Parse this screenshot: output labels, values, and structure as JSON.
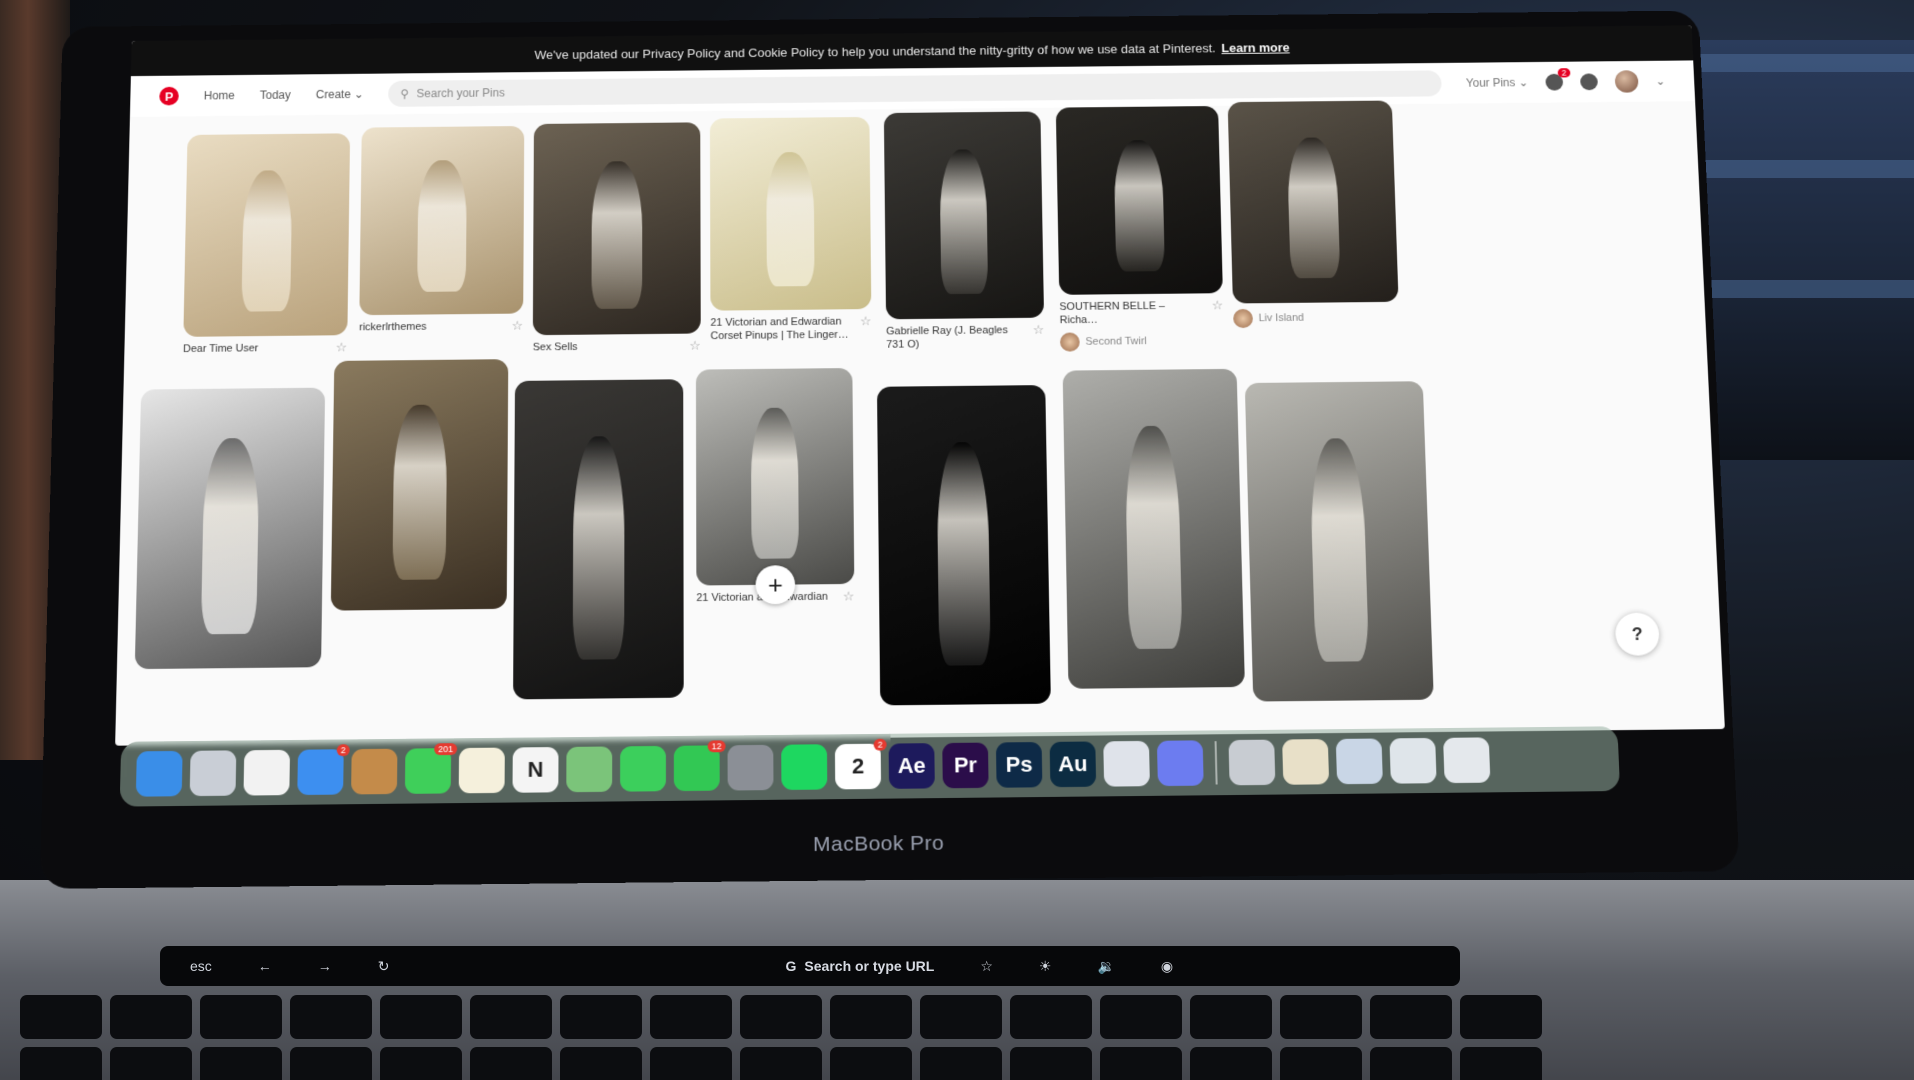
{
  "notice": {
    "text": "We've updated our Privacy Policy and Cookie Policy to help you understand the nitty-gritty of how we use data at Pinterest.",
    "link": "Learn more"
  },
  "nav": {
    "logo": "P",
    "home": "Home",
    "today": "Today",
    "create": "Create",
    "search_placeholder": "Search your Pins",
    "your_pins": "Your Pins",
    "notif_count": "2"
  },
  "pins": [
    {
      "id": "p1",
      "title": "Dear Time User",
      "owner": ""
    },
    {
      "id": "p2",
      "title": "rickerlrthemes",
      "owner": ""
    },
    {
      "id": "p3",
      "title": "Sex Sells",
      "owner": ""
    },
    {
      "id": "p4",
      "title": "21 Victorian and Edwardian Corset Pinups | The Linger…",
      "owner": ""
    },
    {
      "id": "p5",
      "title": "Gabrielle Ray (J. Beagles 731 O)",
      "owner": ""
    },
    {
      "id": "p6",
      "title": "SOUTHERN BELLE – Richa…",
      "owner": "Second Twirl"
    },
    {
      "id": "p7",
      "title": "",
      "owner": "Liv Island"
    },
    {
      "id": "p8",
      "title": "",
      "owner": ""
    },
    {
      "id": "p9",
      "title": "",
      "owner": ""
    },
    {
      "id": "p10",
      "title": "",
      "owner": ""
    },
    {
      "id": "p11",
      "title": "21 Victorian and edwardian",
      "owner": ""
    },
    {
      "id": "p12",
      "title": "",
      "owner": ""
    },
    {
      "id": "p13",
      "title": "",
      "owner": ""
    },
    {
      "id": "p14",
      "title": "",
      "owner": ""
    }
  ],
  "help_label": "?",
  "add_label": "+",
  "dock": {
    "apps": [
      {
        "name": "Finder",
        "label": "",
        "color": "#3a8ee8"
      },
      {
        "name": "Launchpad",
        "label": "",
        "color": "#c9ced6"
      },
      {
        "name": "Chrome",
        "label": "",
        "color": "#f2f2f2"
      },
      {
        "name": "Mail",
        "label": "",
        "color": "#3d8ff0",
        "badge": "2"
      },
      {
        "name": "Contacts",
        "label": "",
        "color": "#c48b4a"
      },
      {
        "name": "Messages",
        "label": "",
        "color": "#3fcf5a",
        "badge": "201"
      },
      {
        "name": "Notes",
        "label": "",
        "color": "#f5f0dc"
      },
      {
        "name": "Notion",
        "label": "N",
        "color": "#f4f4f4"
      },
      {
        "name": "Maps",
        "label": "",
        "color": "#7bc47a"
      },
      {
        "name": "FaceTime",
        "label": "",
        "color": "#3ccf5c"
      },
      {
        "name": "WhatsApp",
        "label": "",
        "color": "#32c854",
        "badge": "12"
      },
      {
        "name": "System Settings",
        "label": "",
        "color": "#8b8f96"
      },
      {
        "name": "Spotify",
        "label": "",
        "color": "#1ed760"
      },
      {
        "name": "Calendar",
        "label": "2",
        "color": "#ffffff",
        "badge": "2"
      },
      {
        "name": "After Effects",
        "label": "Ae",
        "color": "#1d1a5c"
      },
      {
        "name": "Premiere",
        "label": "Pr",
        "color": "#2b0d4a"
      },
      {
        "name": "Photoshop",
        "label": "Ps",
        "color": "#0e2a47"
      },
      {
        "name": "Audition",
        "label": "Au",
        "color": "#0c2c42"
      },
      {
        "name": "QuickTime",
        "label": "",
        "color": "#dfe3ea"
      },
      {
        "name": "Discord",
        "label": "",
        "color": "#6c7cf0"
      }
    ],
    "right_apps": [
      {
        "name": "Downloads",
        "label": "",
        "color": "#c8ccd2"
      },
      {
        "name": "Preview",
        "label": "",
        "color": "#e8e0c8"
      },
      {
        "name": "Screenshot",
        "label": "",
        "color": "#c9d6e6"
      },
      {
        "name": "Files",
        "label": "",
        "color": "#dfe5ea"
      },
      {
        "name": "Trash",
        "label": "",
        "color": "#e4e8ec"
      }
    ]
  },
  "brand": "MacBook Pro",
  "touchbar": {
    "esc": "esc",
    "search": "Search or type URL"
  }
}
